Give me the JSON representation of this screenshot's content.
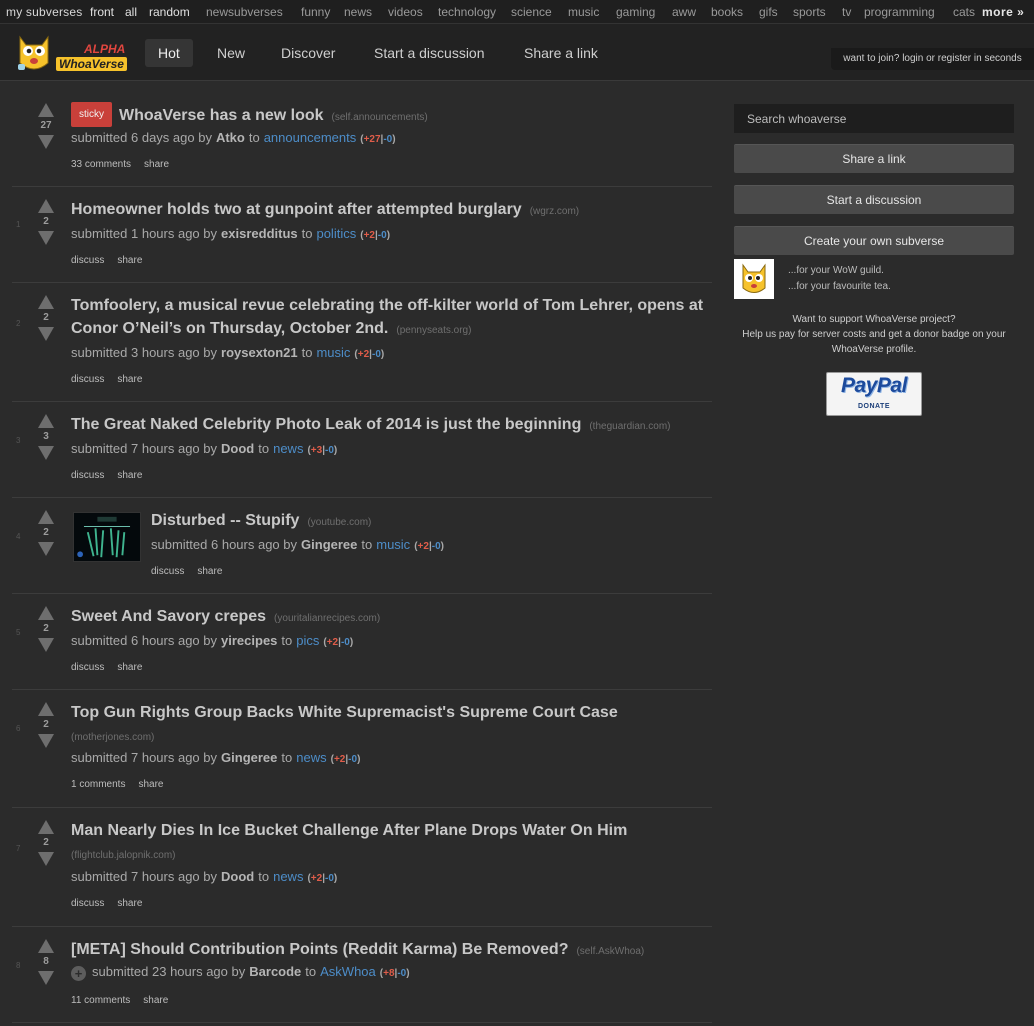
{
  "topbar": {
    "my_subverses": "my subverses",
    "links": [
      "front",
      "all",
      "random",
      "newsubverses",
      "funny",
      "news",
      "videos",
      "technology",
      "science",
      "music",
      "gaming",
      "aww",
      "books",
      "gifs",
      "sports",
      "tv",
      "programming",
      "cats"
    ],
    "more": "more »"
  },
  "header": {
    "logo_alpha": "ALPHA",
    "logo_text": "WhoaVerse",
    "tabs": [
      "Hot",
      "New",
      "Discover",
      "Start a discussion",
      "Share a link"
    ],
    "active_tab": "Hot",
    "join_text": "want to join? login or register in seconds"
  },
  "posts": [
    {
      "rank": "",
      "score": "27",
      "sticky": "sticky",
      "title": "WhoaVerse has a new look",
      "domain": "(self.announcements)",
      "time": "6 days ago",
      "user": "Atko",
      "subverse": "announcements",
      "up": "+27",
      "down": "-0",
      "comments": "33 comments",
      "share": "share"
    },
    {
      "rank": "1",
      "score": "2",
      "title": "Homeowner holds two at gunpoint after attempted burglary",
      "domain": "(wgrz.com)",
      "time": "1 hours ago",
      "user": "exisredditus",
      "subverse": "politics",
      "up": "+2",
      "down": "-0",
      "comments": "discuss",
      "share": "share"
    },
    {
      "rank": "2",
      "score": "2",
      "title": "Tomfoolery, a musical revue celebrating the off-kilter world of Tom Lehrer, opens at Conor O’Neil’s on Thursday, October 2nd.",
      "domain": "(pennyseats.org)",
      "time": "3 hours ago",
      "user": "roysexton21",
      "subverse": "music",
      "up": "+2",
      "down": "-0",
      "comments": "discuss",
      "share": "share"
    },
    {
      "rank": "3",
      "score": "3",
      "title": "The Great Naked Celebrity Photo Leak of 2014 is just the beginning",
      "domain": "(theguardian.com)",
      "time": "7 hours ago",
      "user": "Dood",
      "subverse": "news",
      "up": "+3",
      "down": "-0",
      "comments": "discuss",
      "share": "share"
    },
    {
      "rank": "4",
      "score": "2",
      "title": "Disturbed -- Stupify",
      "domain": "(youtube.com)",
      "time": "6 hours ago",
      "user": "Gingeree",
      "subverse": "music",
      "up": "+2",
      "down": "-0",
      "comments": "discuss",
      "share": "share"
    },
    {
      "rank": "5",
      "score": "2",
      "title": "Sweet And Savory crepes",
      "domain": "(youritalianrecipes.com)",
      "time": "6 hours ago",
      "user": "yirecipes",
      "subverse": "pics",
      "up": "+2",
      "down": "-0",
      "comments": "discuss",
      "share": "share"
    },
    {
      "rank": "6",
      "score": "2",
      "title": "Top Gun Rights Group Backs White Supremacist's Supreme Court Case",
      "domain": "(motherjones.com)",
      "time": "7 hours ago",
      "user": "Gingeree",
      "subverse": "news",
      "up": "+2",
      "down": "-0",
      "comments": "1 comments",
      "share": "share"
    },
    {
      "rank": "7",
      "score": "2",
      "title": "Man Nearly Dies In Ice Bucket Challenge After Plane Drops Water On Him",
      "domain": "(flightclub.jalopnik.com)",
      "time": "7 hours ago",
      "user": "Dood",
      "subverse": "news",
      "up": "+2",
      "down": "-0",
      "comments": "discuss",
      "share": "share"
    },
    {
      "rank": "8",
      "score": "8",
      "title": "[META] Should Contribution Points (Reddit Karma) Be Removed?",
      "domain": "(self.AskWhoa)",
      "time": "23 hours ago",
      "user": "Barcode",
      "subverse": "AskWhoa",
      "up": "+8",
      "down": "-0",
      "comments": "11 comments",
      "share": "share"
    }
  ],
  "meta_words": {
    "submitted": "submitted",
    "by": "by",
    "to": "to"
  },
  "sidebar": {
    "search_placeholder": "Search whoaverse",
    "share_link": "Share a link",
    "start_discussion": "Start a discussion",
    "create_subverse": "Create your own subverse",
    "ad_line1": "...for your WoW guild.",
    "ad_line2": "...for your favourite tea.",
    "donate_text_1": "Want to support WhoaVerse project?",
    "donate_text_2": "Help us pay for server costs and get a donor badge on your WhoaVerse profile.",
    "paypal": "PayPal",
    "paypal_donate": "DONATE"
  },
  "colors": {
    "accent_up": "#e05d4a",
    "accent_link": "#4d8dc8",
    "sticky": "#c9403a"
  }
}
